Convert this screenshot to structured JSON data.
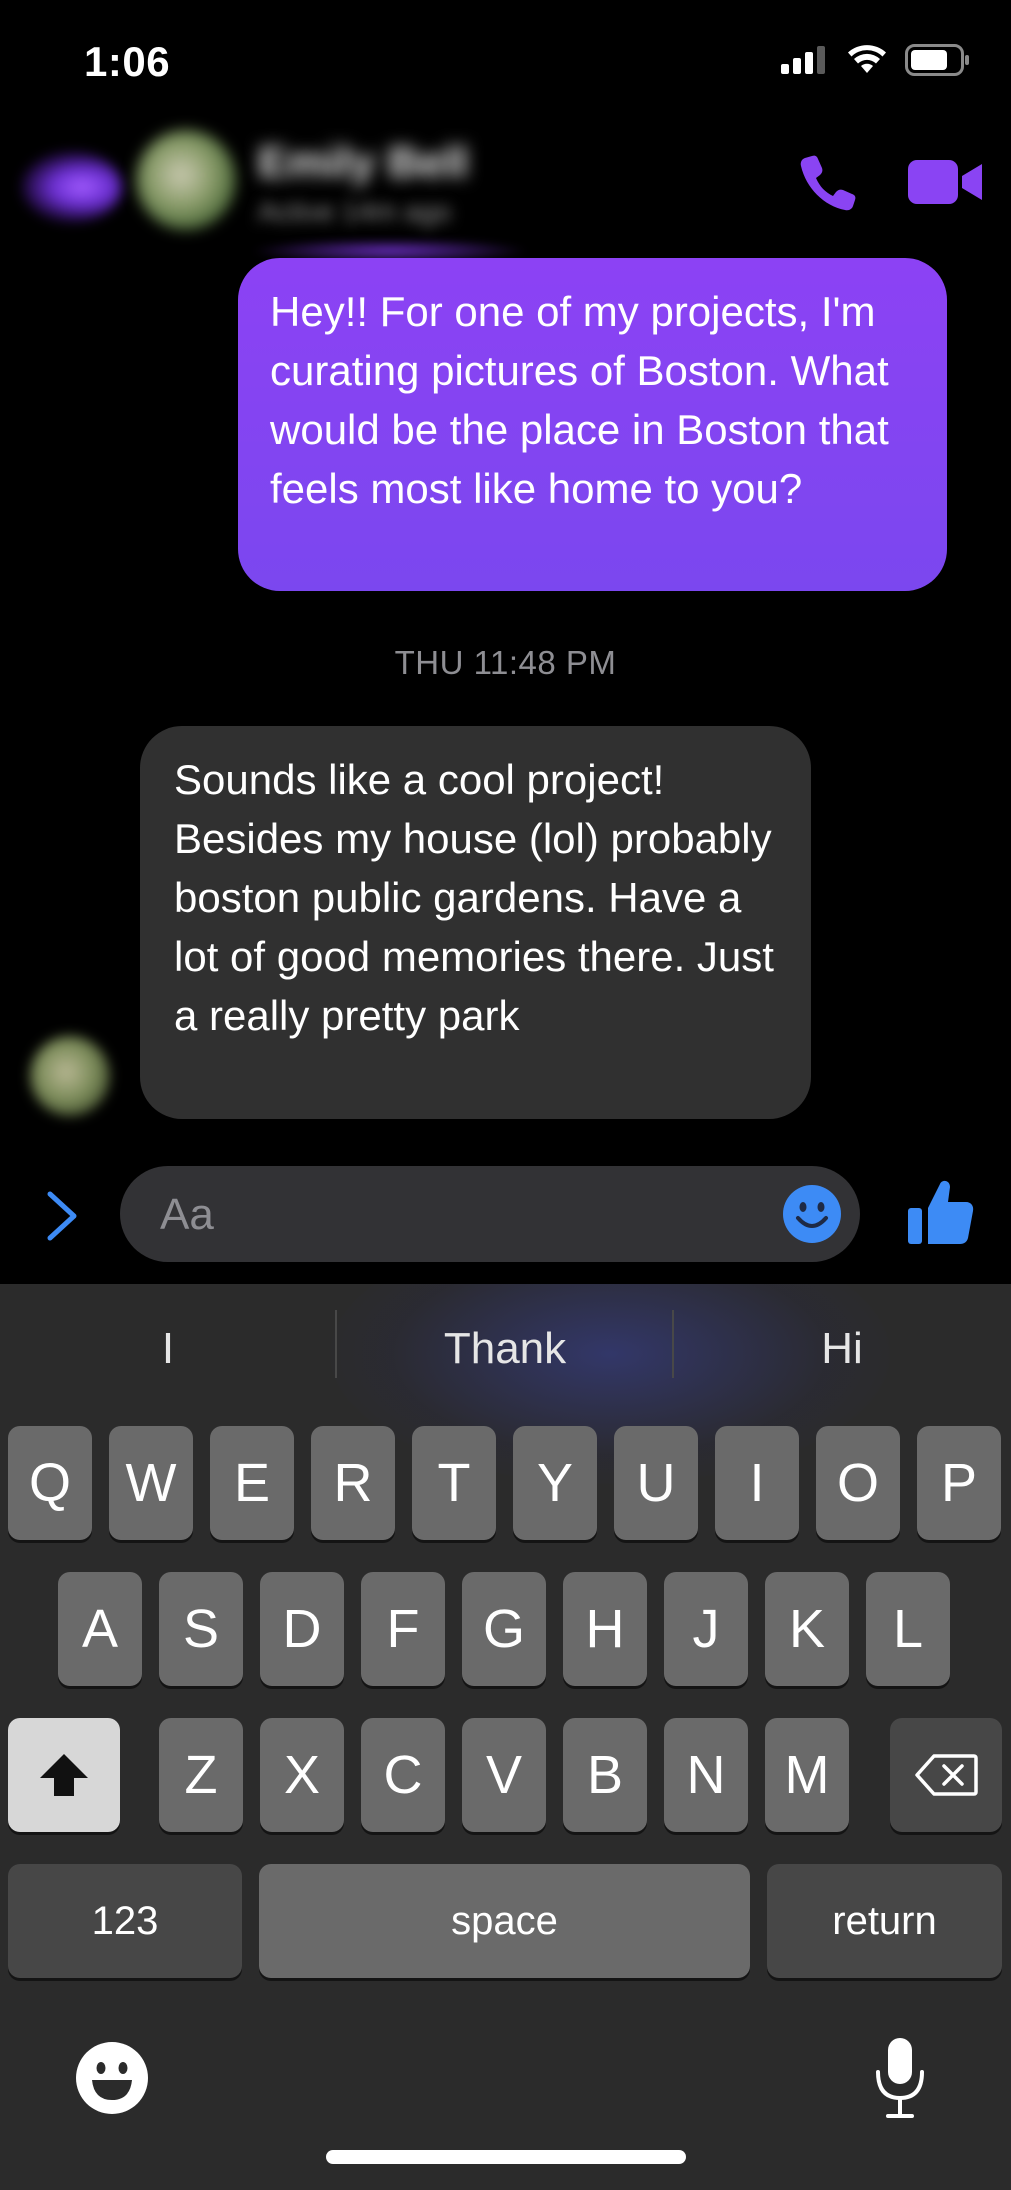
{
  "status_bar": {
    "time": "1:06"
  },
  "header": {
    "contact_name": "Emily Bell",
    "contact_status": "Active 14m ago"
  },
  "messages": {
    "outgoing_text": "Hey!! For one of my projects, I'm curating pictures of Boston. What would be the place in Boston that feels most like home to you?",
    "timestamp": "THU 11:48 PM",
    "incoming_text": "Sounds like a cool project! Besides my house (lol) probably boston public gardens. Have a lot of good memories there. Just a really pretty park"
  },
  "composer": {
    "placeholder": "Aa"
  },
  "keyboard": {
    "suggestions": [
      "I",
      "Thank",
      "Hi"
    ],
    "row1": [
      "Q",
      "W",
      "E",
      "R",
      "T",
      "Y",
      "U",
      "I",
      "O",
      "P"
    ],
    "row2": [
      "A",
      "S",
      "D",
      "F",
      "G",
      "H",
      "J",
      "K",
      "L"
    ],
    "row3": [
      "Z",
      "X",
      "C",
      "V",
      "B",
      "N",
      "M"
    ],
    "numbers_label": "123",
    "space_label": "space",
    "return_label": "return"
  },
  "colors": {
    "accent": "#8a44f3",
    "outgoing_bubble": "#7b47ef",
    "incoming_bubble": "#303030",
    "emoji_blue": "#3d8bf5"
  },
  "icons": [
    "back-icon",
    "phone-icon",
    "video-icon",
    "chevron-right-icon",
    "smiley-icon",
    "thumbs-up-icon",
    "shift-icon",
    "delete-icon",
    "emoji-keyboard-icon",
    "microphone-icon"
  ]
}
